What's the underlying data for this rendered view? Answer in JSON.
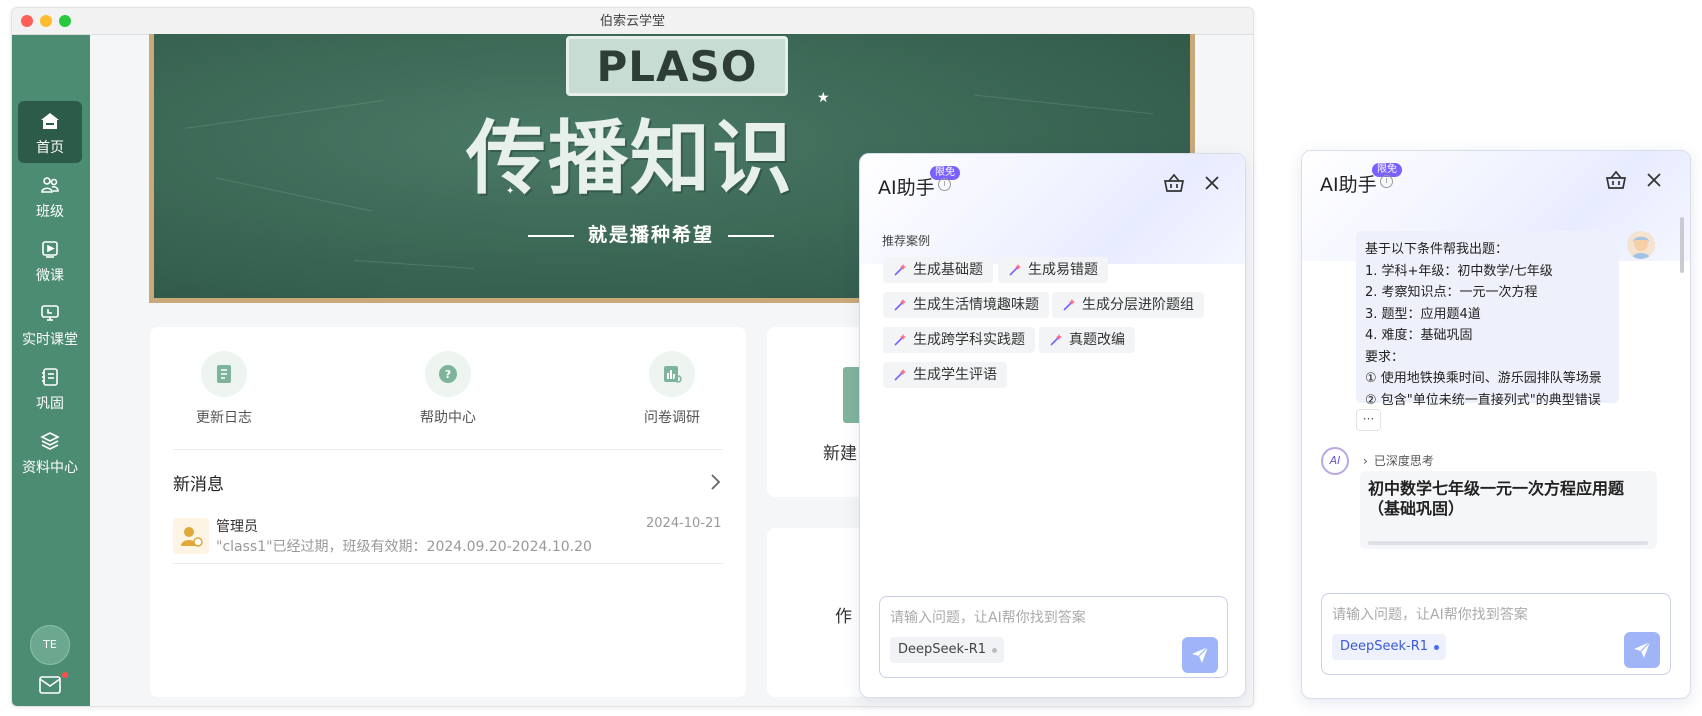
{
  "window": {
    "title": "伯索云学堂"
  },
  "sidebar": {
    "items": [
      {
        "label": "首页",
        "icon": "home-icon",
        "active": true
      },
      {
        "label": "班级",
        "icon": "users-icon"
      },
      {
        "label": "微课",
        "icon": "video-icon"
      },
      {
        "label": "实时课堂",
        "icon": "live-class-icon"
      },
      {
        "label": "巩固",
        "icon": "notebook-icon"
      },
      {
        "label": "资料中心",
        "icon": "layers-icon"
      }
    ],
    "avatar": "TE"
  },
  "banner": {
    "logo": "PLASO",
    "slogan": "传播知识",
    "subslogan": "就是播种希望"
  },
  "quick_links": [
    {
      "label": "更新日志",
      "icon": "log-icon"
    },
    {
      "label": "帮助中心",
      "icon": "help-icon"
    },
    {
      "label": "问卷调研",
      "icon": "survey-icon"
    }
  ],
  "messages": {
    "title": "新消息",
    "items": [
      {
        "sender": "管理员",
        "date": "2024-10-21",
        "body": "\"class1\"已经过期，班级有效期：2024.09.20-2024.10.20"
      }
    ]
  },
  "right_cards": {
    "new_label": "新建",
    "work_label": "作"
  },
  "ai_panel": {
    "title": "AI助手",
    "badge": "限免",
    "info": "i",
    "recommend_title": "推荐案例",
    "chips": [
      "生成基础题",
      "生成易错题",
      "生成生活情境趣味题",
      "生成分层进阶题组",
      "生成跨学科实践题",
      "真题改编",
      "生成学生评语"
    ],
    "input_placeholder": "请输入问题，让AI帮你找到答案",
    "model": "DeepSeek-R1"
  },
  "ai_chat": {
    "title": "AI助手",
    "badge": "限免",
    "info": "i",
    "user_message": [
      "基于以下条件帮我出题：",
      "1. 学科+年级：初中数学/七年级",
      "2. 考察知识点：一元一次方程",
      "3. 题型：应用题4道",
      "4. 难度：基础巩固",
      "要求：",
      "① 使用地铁换乘时间、游乐园排队等场景",
      "② 包含\"单位未统一直接列式\"的典型错误"
    ],
    "more": "···",
    "ai_avatar": "AI",
    "thinking": "已深度思考",
    "answer_title": "初中数学七年级一元一次方程应用题（基础巩固）",
    "input_placeholder": "请输入问题，让AI帮你找到答案",
    "model": "DeepSeek-R1"
  },
  "colors": {
    "sidebar": "#4c8c72",
    "sidebar_active": "#2d5b49",
    "chalkboard": "#3e6a58",
    "accent": "#7b61ff",
    "send": "#9fb5f7",
    "model_dot_active": "#4a6cf7"
  }
}
